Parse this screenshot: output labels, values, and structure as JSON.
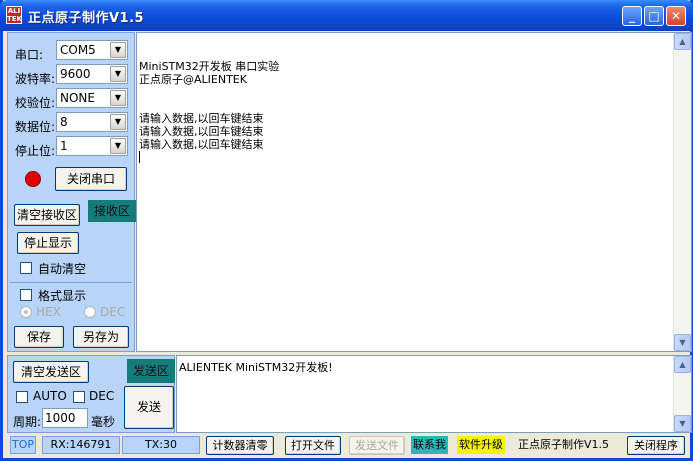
{
  "window": {
    "title": "正点原子制作V1.5",
    "icon_text": "ALI\nTEK"
  },
  "titlebar_buttons": {
    "minimize": "_",
    "maximize": "□",
    "close": "✕"
  },
  "settings": {
    "port_label": "串口:",
    "port_value": "COM5",
    "baud_label": "波特率:",
    "baud_value": "9600",
    "parity_label": "校验位:",
    "parity_value": "NONE",
    "databits_label": "数据位:",
    "databits_value": "8",
    "stopbits_label": "停止位:",
    "stopbits_value": "1"
  },
  "status_led_color": "#e00000",
  "close_port_label": "关闭串口",
  "receive": {
    "clear_label": "清空接收区",
    "area_tag": "接收区",
    "stop_display_label": "停止显示",
    "auto_clear_label": "自动清空",
    "format_display_label": "格式显示",
    "hex_label": "HEX",
    "dec_label": "DEC",
    "save_label": "保存",
    "save_as_label": "另存为",
    "lines": [
      "MiniSTM32开发板 串口实验",
      "正点原子@ALIENTEK",
      "",
      "",
      "请输入数据,以回车键结束",
      "请输入数据,以回车键结束",
      "请输入数据,以回车键结束"
    ]
  },
  "send": {
    "clear_label": "清空发送区",
    "area_tag": "发送区",
    "auto_label": "AUTO",
    "dec_label": "DEC",
    "period_label": "周期:",
    "period_value": "1000",
    "period_unit": "毫秒",
    "send_label": "发送",
    "text": "ALIENTEK MiniSTM32开发板!"
  },
  "statusbar": {
    "top_label": "TOP",
    "rx": "RX:146791",
    "tx": "TX:30",
    "reset_counter": "计数器清零",
    "open_file": "打开文件",
    "send_file": "发送文件",
    "contact": "联系我",
    "upgrade": "软件升级",
    "author": "正点原子制作V1.5",
    "close_program": "关闭程序"
  },
  "colors": {
    "titlebar": "#0a4ad8",
    "panel": "#b8d4f8",
    "teal_tag": "#167b7b",
    "contact_bg": "#29b8b8",
    "upgrade_bg": "#f4f400"
  }
}
